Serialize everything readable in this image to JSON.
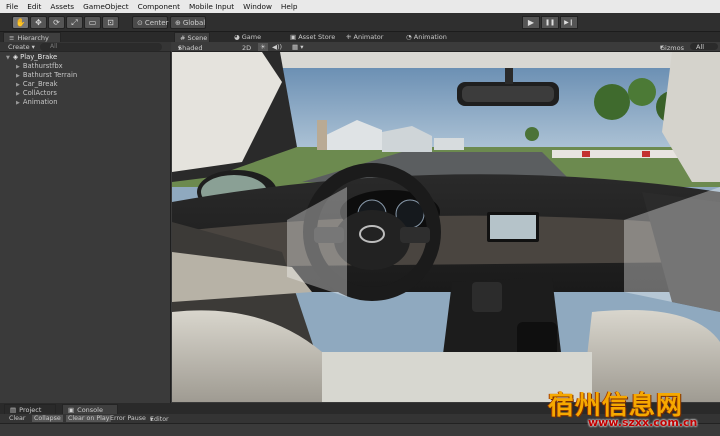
{
  "menu": [
    "File",
    "Edit",
    "Assets",
    "GameObject",
    "Component",
    "Mobile Input",
    "Window",
    "Help"
  ],
  "toolbar": {
    "tools": [
      "hand-tool",
      "move-tool",
      "rotate-tool",
      "scale-tool",
      "rect-tool",
      "transform-tool"
    ],
    "pivot_label": "Center",
    "space_label": "Global",
    "play_icon": "▶",
    "pause_icon": "❚❚",
    "step_icon": "▶❙"
  },
  "hierarchy": {
    "tab": "Hierarchy",
    "create_label": "Create",
    "search_placeholder": "All",
    "scene_name": "Play_Brake",
    "items": [
      "Bathurstfbx",
      "Bathurst Terrain",
      "Car_Break",
      "CollActors",
      "Animation"
    ]
  },
  "scene": {
    "tabs": [
      "Scene",
      "Game",
      "Asset Store",
      "Animator",
      "Animation"
    ],
    "shading": "Shaded",
    "mode_2d": "2D",
    "gizmos_label": "Gizmos",
    "search_placeholder": "All"
  },
  "console": {
    "tabs": [
      "Project",
      "Console"
    ],
    "buttons": [
      "Clear",
      "Collapse",
      "Clear on Play",
      "Error Pause",
      "Editor"
    ]
  },
  "watermark": {
    "title": "宿州信息网",
    "url": "www.szxx.com.cn"
  },
  "colors": {
    "menubar": "#e9e9e9",
    "editor_dark": "#3a3a3a",
    "watermark_orange": "#f6a800",
    "watermark_red": "#c00000"
  }
}
